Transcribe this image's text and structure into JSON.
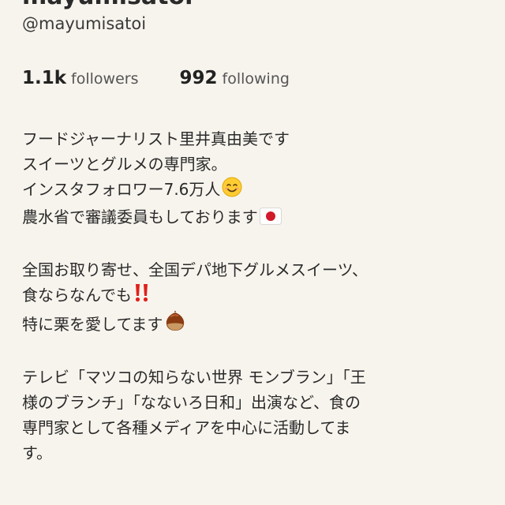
{
  "profile": {
    "name_cut": "mayumisatoi",
    "handle": "@mayumisatoi",
    "followers_count": "1.1k",
    "followers_label": "followers",
    "following_count": "992",
    "following_label": "following"
  },
  "bio": {
    "lines": [
      "フードジャーナリスト里井真由美です",
      "スイーツとグルメの専門家。",
      "インスタフォロワー7.6万人",
      "農水省で審議委員もしております",
      "全国お取り寄せ、全国デパ地下グルメスイーツ、",
      "食ならなんでも",
      "特に栗を愛してます",
      "テレビ「マツコの知らない世界 モンブラン」「王",
      "様のブランチ」「なないろ日和」出演など、食の",
      "専門家として各種メディアを中心に活動してま",
      "す。"
    ],
    "icons": [
      "smiling-face-emoji",
      "japan-flag-emoji",
      "double-exclamation-emoji",
      "chestnut-emoji"
    ]
  },
  "colors": {
    "background": "#f7f4ed",
    "text": "#2a2a2a",
    "exclamation": "#e0201a",
    "chestnut": "#8a3b12"
  }
}
